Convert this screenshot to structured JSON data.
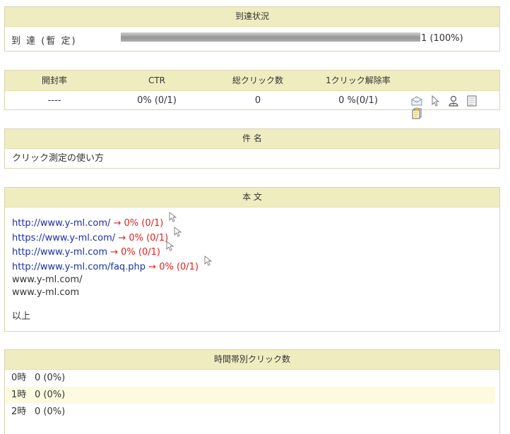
{
  "delivery": {
    "header": "到達状況",
    "label": "到 達 (暫 定)",
    "progress_fraction": 1.0,
    "value_text": "1 (100%)"
  },
  "stats": {
    "headers": [
      "開封率",
      "CTR",
      "総クリック数",
      "1クリック解除率"
    ],
    "values": [
      "----",
      "0% (0/1)",
      "0",
      "0 %(0/1)"
    ],
    "icons": [
      "mail-icon",
      "cursor-icon",
      "user-icon",
      "document-icon",
      "copy-document-icon"
    ]
  },
  "subject": {
    "header": "件 名",
    "text": "クリック測定の使い方"
  },
  "body": {
    "header": "本 文",
    "lines": [
      {
        "link": "http://www.y-ml.com/",
        "rate": " → 0% (0/1)",
        "cursor": true
      },
      {
        "link": "https://www.y-ml.com/",
        "rate": " → 0% (0/1)",
        "cursor": true
      },
      {
        "link": "http://www.y-ml.com",
        "rate": " → 0% (0/1)",
        "cursor": true
      },
      {
        "link": "http://www.y-ml.com/faq.php",
        "rate": " → 0% (0/1)",
        "cursor": true
      }
    ],
    "plain_lines": [
      "www.y-ml.com/",
      "www.y-ml.com",
      "",
      "以上"
    ]
  },
  "hourly": {
    "header": "時間帯別クリック数",
    "rows": [
      {
        "hour": "0時",
        "value": "0 (0%)"
      },
      {
        "hour": "1時",
        "value": "0 (0%)"
      },
      {
        "hour": "2時",
        "value": "0 (0%)"
      }
    ]
  }
}
